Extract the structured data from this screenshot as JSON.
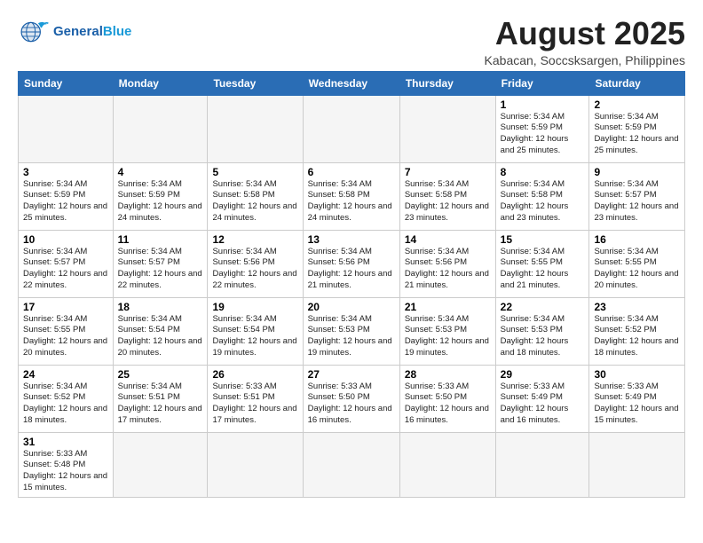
{
  "header": {
    "logo_general": "General",
    "logo_blue": "Blue",
    "month_title": "August 2025",
    "location": "Kabacan, Soccsksargen, Philippines"
  },
  "weekdays": [
    "Sunday",
    "Monday",
    "Tuesday",
    "Wednesday",
    "Thursday",
    "Friday",
    "Saturday"
  ],
  "weeks": [
    [
      {
        "day": "",
        "info": ""
      },
      {
        "day": "",
        "info": ""
      },
      {
        "day": "",
        "info": ""
      },
      {
        "day": "",
        "info": ""
      },
      {
        "day": "",
        "info": ""
      },
      {
        "day": "1",
        "info": "Sunrise: 5:34 AM\nSunset: 5:59 PM\nDaylight: 12 hours\nand 25 minutes."
      },
      {
        "day": "2",
        "info": "Sunrise: 5:34 AM\nSunset: 5:59 PM\nDaylight: 12 hours\nand 25 minutes."
      }
    ],
    [
      {
        "day": "3",
        "info": "Sunrise: 5:34 AM\nSunset: 5:59 PM\nDaylight: 12 hours\nand 25 minutes."
      },
      {
        "day": "4",
        "info": "Sunrise: 5:34 AM\nSunset: 5:59 PM\nDaylight: 12 hours\nand 24 minutes."
      },
      {
        "day": "5",
        "info": "Sunrise: 5:34 AM\nSunset: 5:58 PM\nDaylight: 12 hours\nand 24 minutes."
      },
      {
        "day": "6",
        "info": "Sunrise: 5:34 AM\nSunset: 5:58 PM\nDaylight: 12 hours\nand 24 minutes."
      },
      {
        "day": "7",
        "info": "Sunrise: 5:34 AM\nSunset: 5:58 PM\nDaylight: 12 hours\nand 23 minutes."
      },
      {
        "day": "8",
        "info": "Sunrise: 5:34 AM\nSunset: 5:58 PM\nDaylight: 12 hours\nand 23 minutes."
      },
      {
        "day": "9",
        "info": "Sunrise: 5:34 AM\nSunset: 5:57 PM\nDaylight: 12 hours\nand 23 minutes."
      }
    ],
    [
      {
        "day": "10",
        "info": "Sunrise: 5:34 AM\nSunset: 5:57 PM\nDaylight: 12 hours\nand 22 minutes."
      },
      {
        "day": "11",
        "info": "Sunrise: 5:34 AM\nSunset: 5:57 PM\nDaylight: 12 hours\nand 22 minutes."
      },
      {
        "day": "12",
        "info": "Sunrise: 5:34 AM\nSunset: 5:56 PM\nDaylight: 12 hours\nand 22 minutes."
      },
      {
        "day": "13",
        "info": "Sunrise: 5:34 AM\nSunset: 5:56 PM\nDaylight: 12 hours\nand 21 minutes."
      },
      {
        "day": "14",
        "info": "Sunrise: 5:34 AM\nSunset: 5:56 PM\nDaylight: 12 hours\nand 21 minutes."
      },
      {
        "day": "15",
        "info": "Sunrise: 5:34 AM\nSunset: 5:55 PM\nDaylight: 12 hours\nand 21 minutes."
      },
      {
        "day": "16",
        "info": "Sunrise: 5:34 AM\nSunset: 5:55 PM\nDaylight: 12 hours\nand 20 minutes."
      }
    ],
    [
      {
        "day": "17",
        "info": "Sunrise: 5:34 AM\nSunset: 5:55 PM\nDaylight: 12 hours\nand 20 minutes."
      },
      {
        "day": "18",
        "info": "Sunrise: 5:34 AM\nSunset: 5:54 PM\nDaylight: 12 hours\nand 20 minutes."
      },
      {
        "day": "19",
        "info": "Sunrise: 5:34 AM\nSunset: 5:54 PM\nDaylight: 12 hours\nand 19 minutes."
      },
      {
        "day": "20",
        "info": "Sunrise: 5:34 AM\nSunset: 5:53 PM\nDaylight: 12 hours\nand 19 minutes."
      },
      {
        "day": "21",
        "info": "Sunrise: 5:34 AM\nSunset: 5:53 PM\nDaylight: 12 hours\nand 19 minutes."
      },
      {
        "day": "22",
        "info": "Sunrise: 5:34 AM\nSunset: 5:53 PM\nDaylight: 12 hours\nand 18 minutes."
      },
      {
        "day": "23",
        "info": "Sunrise: 5:34 AM\nSunset: 5:52 PM\nDaylight: 12 hours\nand 18 minutes."
      }
    ],
    [
      {
        "day": "24",
        "info": "Sunrise: 5:34 AM\nSunset: 5:52 PM\nDaylight: 12 hours\nand 18 minutes."
      },
      {
        "day": "25",
        "info": "Sunrise: 5:34 AM\nSunset: 5:51 PM\nDaylight: 12 hours\nand 17 minutes."
      },
      {
        "day": "26",
        "info": "Sunrise: 5:33 AM\nSunset: 5:51 PM\nDaylight: 12 hours\nand 17 minutes."
      },
      {
        "day": "27",
        "info": "Sunrise: 5:33 AM\nSunset: 5:50 PM\nDaylight: 12 hours\nand 16 minutes."
      },
      {
        "day": "28",
        "info": "Sunrise: 5:33 AM\nSunset: 5:50 PM\nDaylight: 12 hours\nand 16 minutes."
      },
      {
        "day": "29",
        "info": "Sunrise: 5:33 AM\nSunset: 5:49 PM\nDaylight: 12 hours\nand 16 minutes."
      },
      {
        "day": "30",
        "info": "Sunrise: 5:33 AM\nSunset: 5:49 PM\nDaylight: 12 hours\nand 15 minutes."
      }
    ],
    [
      {
        "day": "31",
        "info": "Sunrise: 5:33 AM\nSunset: 5:48 PM\nDaylight: 12 hours\nand 15 minutes."
      },
      {
        "day": "",
        "info": ""
      },
      {
        "day": "",
        "info": ""
      },
      {
        "day": "",
        "info": ""
      },
      {
        "day": "",
        "info": ""
      },
      {
        "day": "",
        "info": ""
      },
      {
        "day": "",
        "info": ""
      }
    ]
  ]
}
